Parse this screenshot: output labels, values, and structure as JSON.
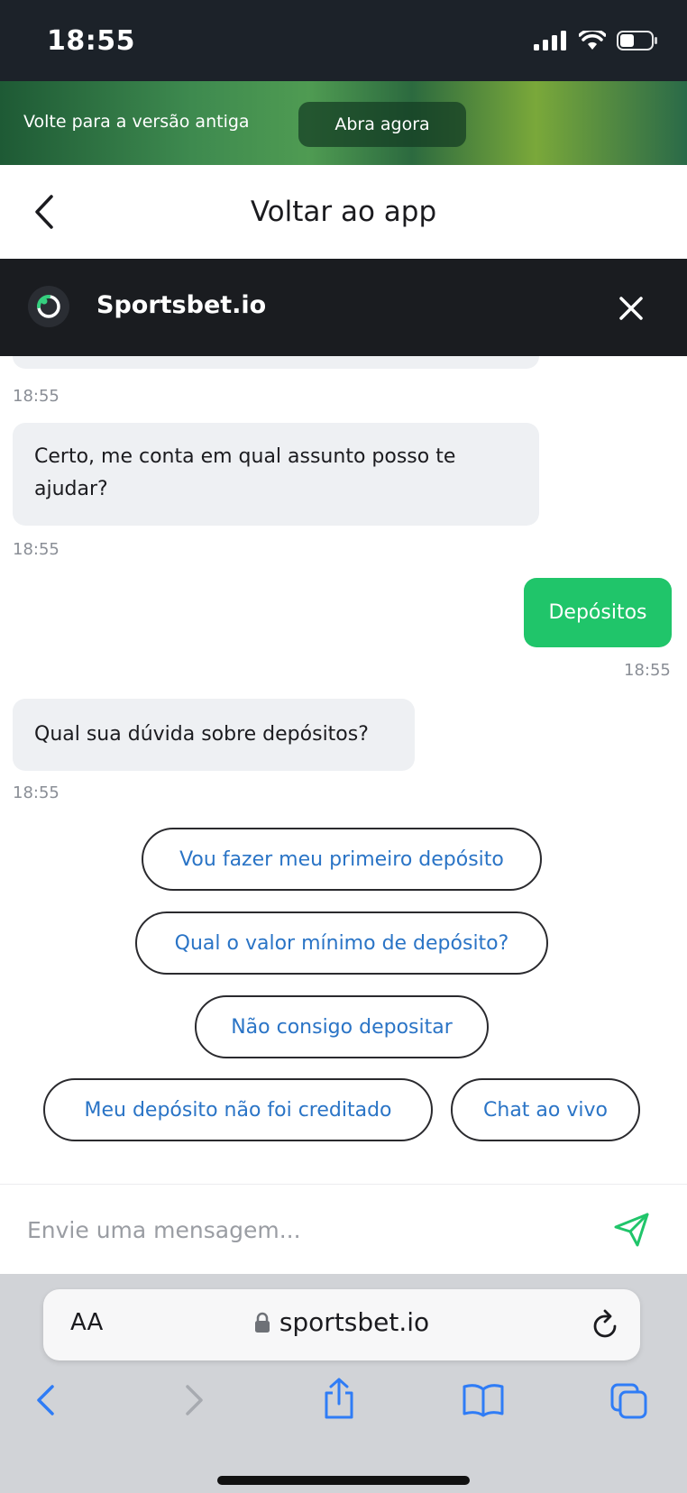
{
  "status_bar": {
    "time": "18:55"
  },
  "banner": {
    "text": "Volte para a versão antiga",
    "button_label": "Abra agora"
  },
  "nav": {
    "title": "Voltar ao app"
  },
  "chat_header": {
    "title": "Sportsbet.io"
  },
  "messages": [
    {
      "from": "agent",
      "text": "",
      "time": "18:55"
    },
    {
      "from": "agent",
      "text": "Certo, me conta em qual assunto posso te ajudar?",
      "time": "18:55"
    },
    {
      "from": "user",
      "text": "Depósitos",
      "time": "18:55"
    },
    {
      "from": "agent",
      "text": "Qual sua dúvida sobre depósitos?",
      "time": "18:55"
    }
  ],
  "quick_replies": [
    "Vou fazer meu primeiro depósito",
    "Qual o valor mínimo de depósito?",
    "Não consigo depositar",
    "Meu depósito não foi creditado",
    "Chat ao vivo"
  ],
  "composer": {
    "placeholder": "Envie uma mensagem..."
  },
  "browser": {
    "aa_label": "AA",
    "url": "sportsbet.io"
  },
  "colors": {
    "accent_green": "#20c56a",
    "chip_text": "#2a74c6",
    "chat_header_bg": "#1a1c20",
    "status_bar_bg": "#1c2229"
  },
  "icons": [
    "signal-icon",
    "wifi-icon",
    "battery-icon",
    "back-chevron-icon",
    "sportsbet-logo-icon",
    "close-icon",
    "send-icon",
    "lock-icon",
    "reload-icon",
    "browser-back-icon",
    "browser-forward-icon",
    "share-icon",
    "bookmarks-icon",
    "tabs-icon"
  ]
}
